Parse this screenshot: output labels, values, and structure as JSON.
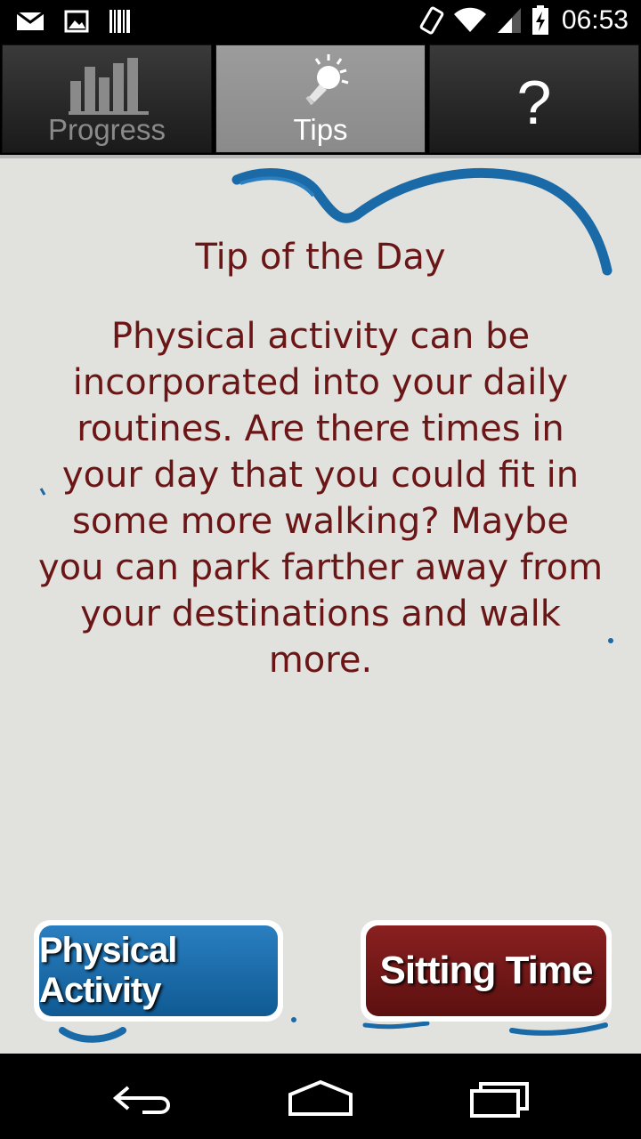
{
  "status_bar": {
    "time": "06:53",
    "icons": [
      "mail-icon",
      "image-icon",
      "barcode-icon",
      "rotate-icon",
      "wifi-icon",
      "signal-icon",
      "battery-charging-icon"
    ]
  },
  "tabs": [
    {
      "label": "Progress",
      "icon": "bar-chart-icon",
      "selected": false
    },
    {
      "label": "Tips",
      "icon": "lightbulb-icon",
      "selected": true
    },
    {
      "label": "?",
      "icon": "help-icon",
      "selected": false
    }
  ],
  "tip": {
    "title": "Tip of the Day",
    "body": "Physical activity can be incorporated into your daily routines. Are there times in your day that you could fit in some more walking? Maybe you can park farther away from your destinations and walk more."
  },
  "buttons": {
    "physical_activity": "Physical Activity",
    "sitting_time": "Sitting Time"
  },
  "nav": {
    "icons": [
      "back-icon",
      "home-icon",
      "recent-apps-icon"
    ]
  },
  "colors": {
    "accent_blue": "#1a6aa8",
    "text_maroon": "#6b1616",
    "sitting_red": "#6e1717",
    "background": "#e1e1de"
  }
}
